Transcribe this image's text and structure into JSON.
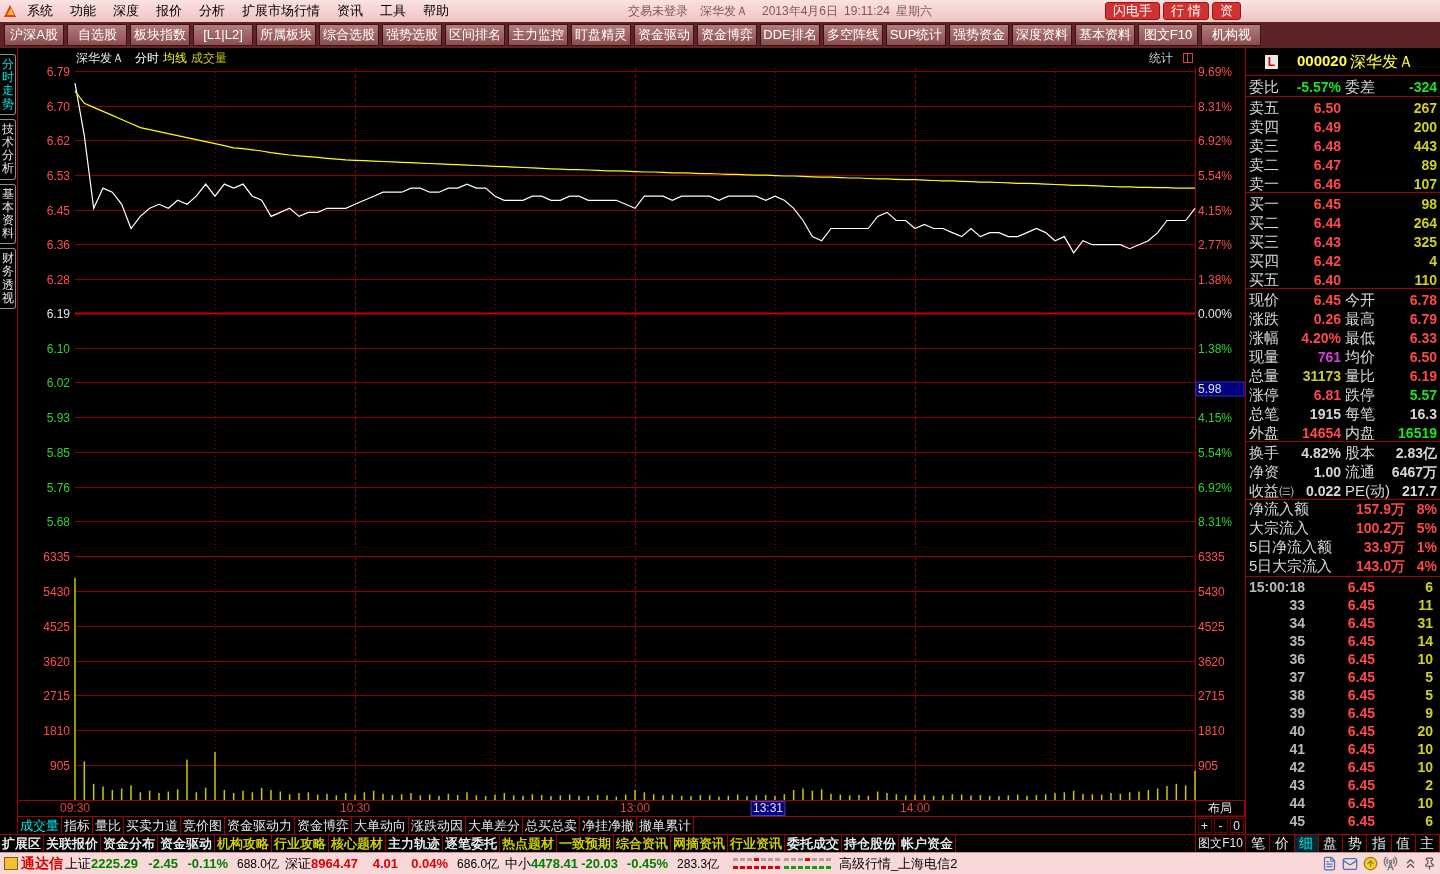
{
  "menu_bar": {
    "items": [
      "系统",
      "功能",
      "深度",
      "报价",
      "分析",
      "扩展市场行情",
      "资讯",
      "工具",
      "帮助"
    ],
    "login_status": "交易未登录",
    "stock_name": "深华发Ａ",
    "date": "2013年4月6日",
    "time": "19:11:24",
    "weekday": "星期六",
    "buttons": [
      "闪电手",
      "行 情",
      "资"
    ]
  },
  "toolbar": {
    "buttons": [
      "沪深A股",
      "自选股",
      "板块指数",
      "[L1|L2]",
      "所属板块",
      "综合选股",
      "强势选股",
      "区间排名",
      "主力监控",
      "盯盘精灵",
      "资金驱动",
      "资金博弈",
      "DDE排名",
      "多空阵线",
      "SUP统计",
      "强势资金",
      "深度资料",
      "基本资料",
      "图文F10",
      "机构视"
    ]
  },
  "side_tabs": [
    {
      "label": "分时走势",
      "selected": true
    },
    {
      "label": "技术分析",
      "selected": false
    },
    {
      "label": "基本资料",
      "selected": false
    },
    {
      "label": "财务透视",
      "selected": false
    }
  ],
  "chart": {
    "stock_name": "深华发Ａ",
    "stats_label": "统计",
    "price_chart": {
      "axis_rows": [
        {
          "change": "9.69%",
          "kind": "up"
        },
        {
          "change": "8.31%",
          "kind": "up"
        },
        {
          "change": "6.92%",
          "kind": "up"
        },
        {
          "change": "5.54%",
          "kind": "up"
        },
        {
          "change": "4.15%",
          "kind": "up"
        },
        {
          "change": "2.77%",
          "kind": "up"
        },
        {
          "change": "1.38%",
          "kind": "up"
        },
        {
          "change": "0.00%",
          "kind": "flat"
        },
        {
          "change": "1.38%",
          "kind": "down"
        },
        {
          "kind": "down"
        },
        {
          "change": "4.15%",
          "kind": "down"
        },
        {
          "change": "5.54%",
          "kind": "down"
        },
        {
          "change": "6.92%",
          "kind": "down"
        },
        {
          "change": "8.31%",
          "kind": "down"
        }
      ],
      "chart_data": {
        "type": "line",
        "grid": true,
        "ylim": [
          5.676,
          6.79
        ],
        "yticks": [
          {
            "value": 6.79,
            "label": "6.79"
          },
          {
            "value": 6.704,
            "label": "6.70"
          },
          {
            "value": 6.619,
            "label": "6.62"
          },
          {
            "value": 6.533,
            "label": "6.53"
          },
          {
            "value": 6.447,
            "label": "6.45"
          },
          {
            "value": 6.361,
            "label": "6.36"
          },
          {
            "value": 6.276,
            "label": "6.28"
          },
          {
            "value": 6.19,
            "label": "6.19"
          },
          {
            "value": 6.104,
            "label": "6.10"
          },
          {
            "value": 6.019,
            "label": "6.02"
          },
          {
            "value": 5.933,
            "label": "5.93"
          },
          {
            "value": 5.847,
            "label": "5.85"
          },
          {
            "value": 5.761,
            "label": "5.76"
          },
          {
            "value": 5.676,
            "label": "5.68"
          }
        ],
        "ref_lines": [
          {
            "axis": "y",
            "value": 6.19
          }
        ],
        "categories": [
          null,
          null,
          null,
          null,
          null,
          null,
          null,
          null,
          null,
          null,
          null,
          null,
          null,
          null,
          null,
          null,
          null,
          null,
          null,
          null,
          null,
          null,
          null,
          null,
          null,
          null,
          null,
          null,
          null,
          null,
          null,
          null,
          null,
          null,
          null,
          null,
          null,
          null,
          null,
          null,
          null,
          null,
          null,
          null,
          null,
          null,
          null,
          null,
          null,
          null,
          null,
          null,
          null,
          null,
          null,
          null,
          null,
          null,
          null,
          null,
          null,
          null,
          null,
          null,
          null,
          null,
          null,
          null,
          null,
          null,
          null,
          null,
          null,
          null,
          null,
          null,
          null,
          null,
          null,
          null,
          null,
          null,
          null,
          null,
          null,
          null,
          null,
          null,
          null,
          null,
          null,
          null,
          null,
          null,
          null,
          null,
          null,
          null,
          null,
          null,
          null,
          null,
          null,
          null,
          null,
          null,
          null,
          null,
          null,
          null,
          null,
          null,
          null,
          null,
          null,
          null,
          null,
          null,
          null,
          null,
          null
        ],
        "series": [
          {
            "name": "分时",
            "color": "#ffffff",
            "values": [
              6.76,
              6.63,
              6.45,
              6.5,
              6.49,
              6.46,
              6.4,
              6.43,
              6.45,
              6.46,
              6.45,
              6.47,
              6.46,
              6.48,
              6.51,
              6.48,
              6.51,
              6.5,
              6.51,
              6.48,
              6.47,
              6.43,
              6.44,
              6.45,
              6.43,
              6.44,
              6.44,
              6.45,
              6.45,
              6.45,
              6.46,
              6.47,
              6.48,
              6.49,
              6.49,
              6.49,
              6.5,
              6.5,
              6.49,
              6.49,
              6.5,
              6.5,
              6.51,
              6.5,
              6.5,
              6.48,
              6.47,
              6.47,
              6.47,
              6.48,
              6.48,
              6.47,
              6.47,
              6.48,
              6.48,
              6.47,
              6.47,
              6.47,
              6.47,
              6.46,
              6.45,
              6.48,
              6.48,
              6.48,
              6.47,
              6.48,
              6.48,
              6.48,
              6.48,
              6.47,
              6.48,
              6.48,
              6.48,
              6.48,
              6.47,
              6.48,
              6.47,
              6.45,
              6.42,
              6.38,
              6.37,
              6.4,
              6.4,
              6.4,
              6.4,
              6.4,
              6.43,
              6.44,
              6.42,
              6.42,
              6.4,
              6.41,
              6.4,
              6.4,
              6.39,
              6.38,
              6.4,
              6.38,
              6.39,
              6.39,
              6.38,
              6.38,
              6.39,
              6.4,
              6.39,
              6.37,
              6.38,
              6.34,
              6.37,
              6.36,
              6.36,
              6.36,
              6.36,
              6.35,
              6.36,
              6.37,
              6.39,
              6.42,
              6.42,
              6.42,
              6.45
            ]
          },
          {
            "name": "均线",
            "color": "#ffff00",
            "values": [
              6.74,
              6.71,
              6.7,
              6.69,
              6.68,
              6.67,
              6.66,
              6.65,
              6.645,
              6.64,
              6.635,
              6.63,
              6.625,
              6.62,
              6.615,
              6.61,
              6.605,
              6.6,
              6.598,
              6.595,
              6.592,
              6.588,
              6.585,
              6.582,
              6.58,
              6.578,
              6.576,
              6.574,
              6.572,
              6.57,
              6.569,
              6.568,
              6.567,
              6.566,
              6.565,
              6.564,
              6.563,
              6.562,
              6.561,
              6.56,
              6.559,
              6.558,
              6.557,
              6.556,
              6.555,
              6.554,
              6.553,
              6.552,
              6.551,
              6.55,
              6.549,
              6.548,
              6.547,
              6.546,
              6.546,
              6.545,
              6.544,
              6.543,
              6.543,
              6.542,
              6.541,
              6.54,
              6.54,
              6.539,
              6.538,
              6.538,
              6.537,
              6.536,
              6.536,
              6.535,
              6.534,
              6.534,
              6.533,
              6.532,
              6.532,
              6.531,
              6.53,
              6.53,
              6.529,
              6.528,
              6.527,
              6.527,
              6.526,
              6.525,
              6.525,
              6.524,
              6.523,
              6.523,
              6.522,
              6.521,
              6.521,
              6.52,
              6.519,
              6.518,
              6.518,
              6.517,
              6.516,
              6.515,
              6.515,
              6.514,
              6.513,
              6.512,
              6.512,
              6.511,
              6.51,
              6.509,
              6.508,
              6.507,
              6.507,
              6.506,
              6.505,
              6.504,
              6.503,
              6.503,
              6.502,
              6.502,
              6.501,
              6.501,
              6.5,
              6.5,
              6.5
            ]
          }
        ],
        "annotations": [
          "5.98"
        ]
      }
    },
    "volume_chart": {
      "right_labels": [
        "6335",
        "5430",
        "4525",
        "3620",
        "2715",
        "1810",
        "905"
      ],
      "layout_button": "布局",
      "chart_data": {
        "type": "bar",
        "grid": true,
        "ylim": [
          0,
          6335
        ],
        "yticks": [
          {
            "value": 6335,
            "label": "6335"
          },
          {
            "value": 5430,
            "label": "5430"
          },
          {
            "value": 4525,
            "label": "4525"
          },
          {
            "value": 3620,
            "label": "3620"
          },
          {
            "value": 2715,
            "label": "2715"
          },
          {
            "value": 1810,
            "label": "1810"
          },
          {
            "value": 905,
            "label": "905"
          }
        ],
        "categories": [
          "09:30",
          null,
          null,
          null,
          null,
          null,
          null,
          null,
          null,
          null,
          null,
          null,
          null,
          null,
          null,
          null,
          null,
          null,
          null,
          null,
          null,
          null,
          null,
          null,
          null,
          null,
          null,
          null,
          null,
          null,
          "10:30",
          null,
          null,
          null,
          null,
          null,
          null,
          null,
          null,
          null,
          null,
          null,
          null,
          null,
          null,
          null,
          null,
          null,
          null,
          null,
          null,
          null,
          null,
          null,
          null,
          null,
          null,
          null,
          null,
          null,
          "13:00",
          null,
          null,
          null,
          null,
          null,
          null,
          null,
          null,
          null,
          null,
          null,
          null,
          null,
          null,
          null,
          null,
          null,
          null,
          null,
          null,
          null,
          null,
          null,
          null,
          null,
          null,
          null,
          null,
          null,
          "14:00",
          null,
          null,
          null,
          null,
          null,
          null,
          null,
          null,
          null,
          null,
          null,
          null,
          null,
          null,
          null,
          null,
          null,
          null,
          null,
          null,
          null,
          null,
          null,
          null,
          null,
          null,
          null,
          null,
          null,
          null
        ],
        "series": [
          {
            "name": "成交量",
            "color": "#c8c800",
            "values": [
              5770,
              1000,
              420,
              350,
              260,
              300,
              380,
              200,
              240,
              180,
              220,
              280,
              1050,
              200,
              320,
              1250,
              260,
              180,
              240,
              200,
              310,
              260,
              220,
              150,
              180,
              200,
              140,
              160,
              120,
              180,
              140,
              200,
              240,
              160,
              130,
              150,
              180,
              120,
              140,
              110,
              160,
              130,
              200,
              120,
              100,
              140,
              180,
              120,
              110,
              150,
              130,
              100,
              120,
              140,
              110,
              100,
              130,
              120,
              90,
              140,
              260,
              200,
              150,
              120,
              140,
              110,
              100,
              130,
              120,
              90,
              110,
              140,
              100,
              120,
              130,
              110,
              150,
              260,
              300,
              240,
              280,
              160,
              140,
              120,
              130,
              110,
              220,
              180,
              150,
              120,
              140,
              130,
              110,
              120,
              150,
              140,
              120,
              130,
              110,
              100,
              120,
              140,
              110,
              130,
              150,
              180,
              200,
              240,
              160,
              150,
              140,
              180,
              160,
              200,
              220,
              260,
              300,
              360,
              420,
              380,
              760
            ]
          }
        ],
        "annotations": [
          "13:31"
        ]
      }
    },
    "indicator_tabs": [
      {
        "label": "成交量",
        "selected": true
      },
      {
        "label": "指标",
        "selected": false
      },
      {
        "label": "量比",
        "selected": false
      },
      {
        "label": "买卖力道",
        "selected": false
      },
      {
        "label": "竞价图",
        "selected": false
      },
      {
        "label": "资金驱动力",
        "selected": false
      },
      {
        "label": "资金博弈",
        "selected": false
      },
      {
        "label": "大单动向",
        "selected": false
      },
      {
        "label": "涨跌动因",
        "selected": false
      },
      {
        "label": "大单差分",
        "selected": false
      },
      {
        "label": "总买总卖",
        "selected": false
      },
      {
        "label": "净挂净撤",
        "selected": false
      },
      {
        "label": "撤单累计",
        "selected": false
      }
    ],
    "zoom_buttons": [
      "+",
      "-",
      "0"
    ],
    "extension_tabs": [
      {
        "label": "扩展区",
        "color": "#ffffff"
      },
      {
        "label": "关联报价",
        "color": "#ffffff"
      },
      {
        "label": "资金分布",
        "color": "#ffffff"
      },
      {
        "label": "资金驱动",
        "color": "#ffffff"
      },
      {
        "label": "机构攻略",
        "color": "#e0e000"
      },
      {
        "label": "行业攻略",
        "color": "#e0e000"
      },
      {
        "label": "核心题材",
        "color": "#e0e000"
      },
      {
        "label": "主力轨迹",
        "color": "#ffffff"
      },
      {
        "label": "逐笔委托",
        "color": "#ffffff"
      },
      {
        "label": "热点题材",
        "color": "#e0e000"
      },
      {
        "label": "一致预期",
        "color": "#e0e000"
      },
      {
        "label": "综合资讯",
        "color": "#e0e000"
      },
      {
        "label": "网摘资讯",
        "color": "#e0e000"
      },
      {
        "label": "行业资讯",
        "color": "#e0e000"
      },
      {
        "label": "委托成交",
        "color": "#ffffff"
      },
      {
        "label": "持仓股份",
        "color": "#ffffff"
      },
      {
        "label": "帐户资金",
        "color": "#ffffff"
      }
    ],
    "f10_button": "图文F10"
  },
  "quote_panel": {
    "badge": "L",
    "code": "000020",
    "name": "深华发Ａ",
    "order_summary": [
      {
        "label": "委比",
        "value": "-5.57%",
        "color": "#20e020"
      },
      {
        "label": "委差",
        "value": "-324",
        "color": "#20e020"
      }
    ],
    "asks": [
      {
        "label": "卖五",
        "price": "6.50",
        "volume": "267"
      },
      {
        "label": "卖四",
        "price": "6.49",
        "volume": "200"
      },
      {
        "label": "卖三",
        "price": "6.48",
        "volume": "443"
      },
      {
        "label": "卖二",
        "price": "6.47",
        "volume": "89"
      },
      {
        "label": "卖一",
        "price": "6.46",
        "volume": "107"
      }
    ],
    "bids": [
      {
        "label": "买一",
        "price": "6.45",
        "volume": "98"
      },
      {
        "label": "买二",
        "price": "6.44",
        "volume": "264"
      },
      {
        "label": "买三",
        "price": "6.43",
        "volume": "325"
      },
      {
        "label": "买四",
        "price": "6.42",
        "volume": "4"
      },
      {
        "label": "买五",
        "price": "6.40",
        "volume": "110"
      }
    ],
    "stats": [
      {
        "cells": [
          {
            "label": "现价",
            "value": "6.45",
            "color": "#ff4848"
          },
          {
            "label": "今开",
            "value": "6.78",
            "color": "#ff4848"
          }
        ]
      },
      {
        "cells": [
          {
            "label": "涨跌",
            "value": "0.26",
            "color": "#ff4848"
          },
          {
            "label": "最高",
            "value": "6.79",
            "color": "#ff4848"
          }
        ]
      },
      {
        "cells": [
          {
            "label": "涨幅",
            "value": "4.20%",
            "color": "#ff4848"
          },
          {
            "label": "最低",
            "value": "6.33",
            "color": "#ff4848"
          }
        ]
      },
      {
        "cells": [
          {
            "label": "现量",
            "value": "761",
            "color": "#d040d0"
          },
          {
            "label": "均价",
            "value": "6.50",
            "color": "#ff4848"
          }
        ]
      },
      {
        "cells": [
          {
            "label": "总量",
            "value": "31173",
            "color": "#d0d020"
          },
          {
            "label": "量比",
            "value": "6.19",
            "color": "#ff4848"
          }
        ]
      },
      {
        "cells": [
          {
            "label": "涨停",
            "value": "6.81",
            "color": "#ff4848"
          },
          {
            "label": "跌停",
            "value": "5.57",
            "color": "#20e020"
          }
        ]
      },
      {
        "cells": [
          {
            "label": "总笔",
            "value": "1915",
            "color": "#d8d8d8"
          },
          {
            "label": "每笔",
            "value": "16.3",
            "color": "#d8d8d8"
          }
        ]
      },
      {
        "cells": [
          {
            "label": "外盘",
            "value": "14654",
            "color": "#ff4848"
          },
          {
            "label": "内盘",
            "value": "16519",
            "color": "#20e020"
          }
        ]
      }
    ],
    "fundamentals": [
      {
        "cells": [
          {
            "label": "换手",
            "value": "4.82%"
          },
          {
            "label": "股本",
            "value": "2.83亿"
          }
        ]
      },
      {
        "cells": [
          {
            "label": "净资",
            "value": "1.00"
          },
          {
            "label": "流通",
            "value": "6467万"
          }
        ]
      },
      {
        "cells": [
          {
            "label": "收益㈢",
            "value": "0.022"
          },
          {
            "label": "PE(动)",
            "value": "217.7"
          }
        ]
      }
    ],
    "fund_flow": [
      {
        "label": "净流入额",
        "amount": "157.9万",
        "percent": "8%"
      },
      {
        "label": "大宗流入",
        "amount": "100.2万",
        "percent": "5%"
      },
      {
        "label": "5日净流入额",
        "amount": "33.9万",
        "percent": "1%"
      },
      {
        "label": "5日大宗流入",
        "amount": "143.0万",
        "percent": "4%"
      }
    ],
    "ticks": [
      {
        "time": "15:00:18",
        "price": "6.45",
        "volume": "6"
      },
      {
        "time": "33",
        "price": "6.45",
        "volume": "11"
      },
      {
        "time": "34",
        "price": "6.45",
        "volume": "31"
      },
      {
        "time": "35",
        "price": "6.45",
        "volume": "14"
      },
      {
        "time": "36",
        "price": "6.45",
        "volume": "10"
      },
      {
        "time": "37",
        "price": "6.45",
        "volume": "5"
      },
      {
        "time": "38",
        "price": "6.45",
        "volume": "5"
      },
      {
        "time": "39",
        "price": "6.45",
        "volume": "9"
      },
      {
        "time": "40",
        "price": "6.45",
        "volume": "20"
      },
      {
        "time": "41",
        "price": "6.45",
        "volume": "10"
      },
      {
        "time": "42",
        "price": "6.45",
        "volume": "10"
      },
      {
        "time": "43",
        "price": "6.45",
        "volume": "2"
      },
      {
        "time": "44",
        "price": "6.45",
        "volume": "10"
      },
      {
        "time": "45",
        "price": "6.45",
        "volume": "6"
      }
    ],
    "tabs": [
      {
        "label": "笔",
        "selected": false
      },
      {
        "label": "价",
        "selected": false
      },
      {
        "label": "细",
        "selected": true
      },
      {
        "label": "盘",
        "selected": false
      },
      {
        "label": "势",
        "selected": false
      },
      {
        "label": "指",
        "selected": false
      },
      {
        "label": "值",
        "selected": false
      },
      {
        "label": "主",
        "selected": false
      }
    ]
  },
  "status_bar": {
    "brand": "通达信",
    "indices": [
      {
        "name": "上证",
        "value": "2225.29",
        "change": "-2.45",
        "percent": "-0.11%",
        "amount": "688.0亿",
        "color": "#008000"
      },
      {
        "name": "深证",
        "value": "8964.47",
        "change": "4.01",
        "percent": "0.04%",
        "amount": "686.0亿",
        "color": "#e00000"
      },
      {
        "name": "中小",
        "value": "4478.41",
        "change": "-20.03",
        "percent": "-0.45%",
        "amount": "283.3亿",
        "color": "#008000"
      }
    ],
    "server": "高级行情_上海电信2"
  }
}
